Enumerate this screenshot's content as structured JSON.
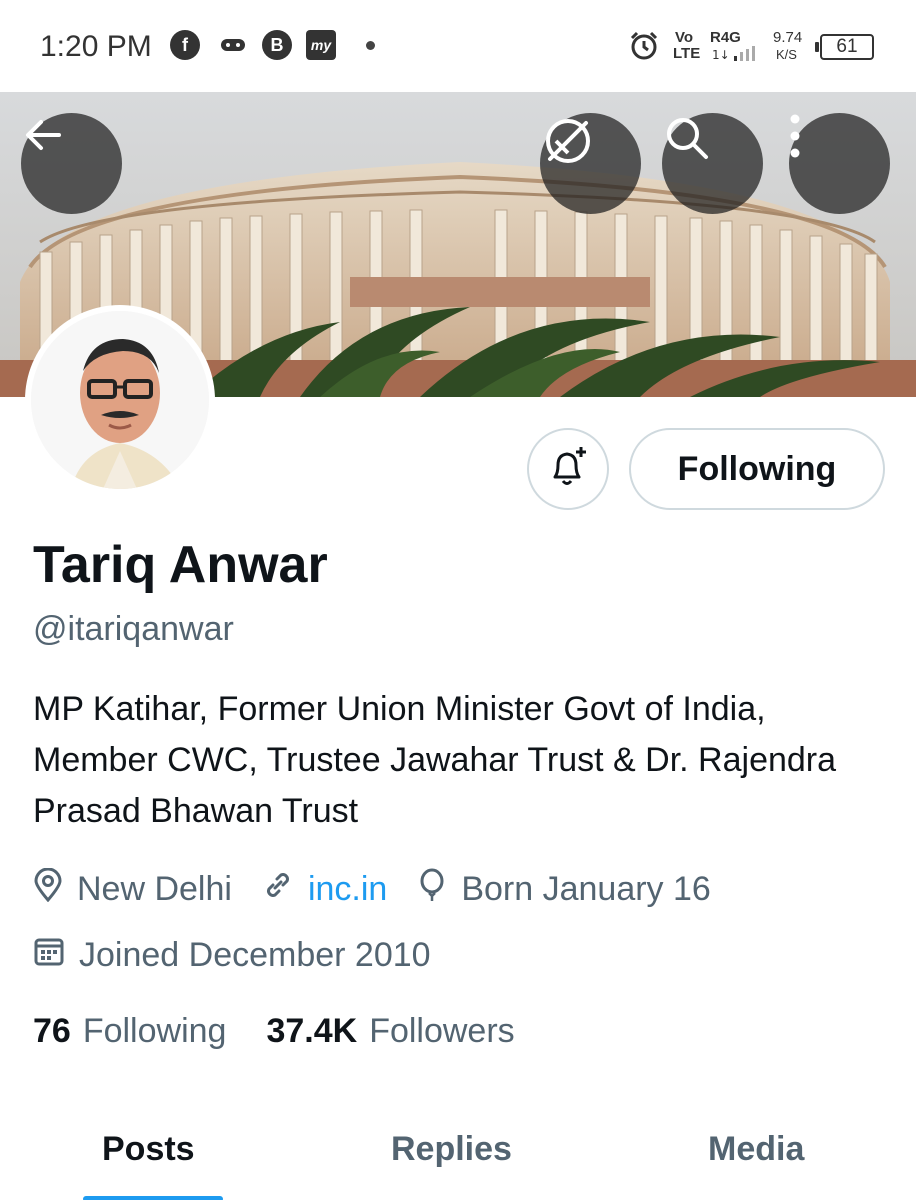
{
  "status_bar": {
    "time": "1:20 PM",
    "app_icons": [
      "facebook-icon",
      "gamepad-icon",
      "b-app-icon",
      "my-app-icon"
    ],
    "network_vo": "Vo",
    "network_lte": "LTE",
    "network_r4g": "R4G",
    "speed_value": "9.74",
    "speed_unit": "K/S",
    "battery": "61"
  },
  "header": {
    "back_icon": "back-arrow-icon",
    "buttons": [
      "no-sync-icon",
      "search-icon",
      "more-icon"
    ]
  },
  "profile": {
    "name": "Tariq Anwar",
    "handle": "@itariqanwar",
    "bio": "MP Katihar, Former Union Minister Govt of India, Member CWC, Trustee Jawahar Trust & Dr. Rajendra Prasad Bhawan Trust",
    "location": "New Delhi",
    "website": "inc.in",
    "birthday": "Born January 16",
    "joined": "Joined December 2010",
    "following_count": "76",
    "following_label": "Following",
    "followers_count": "37.4K",
    "followers_label": "Followers"
  },
  "actions": {
    "notify_icon": "bell-plus-icon",
    "following_button": "Following"
  },
  "tabs": [
    {
      "label": "Posts",
      "active": true
    },
    {
      "label": "Replies",
      "active": false
    },
    {
      "label": "Media",
      "active": false
    }
  ],
  "colors": {
    "accent": "#1d9bf0",
    "text_primary": "#0f1419",
    "text_secondary": "#536471",
    "border": "#cfd9de"
  }
}
